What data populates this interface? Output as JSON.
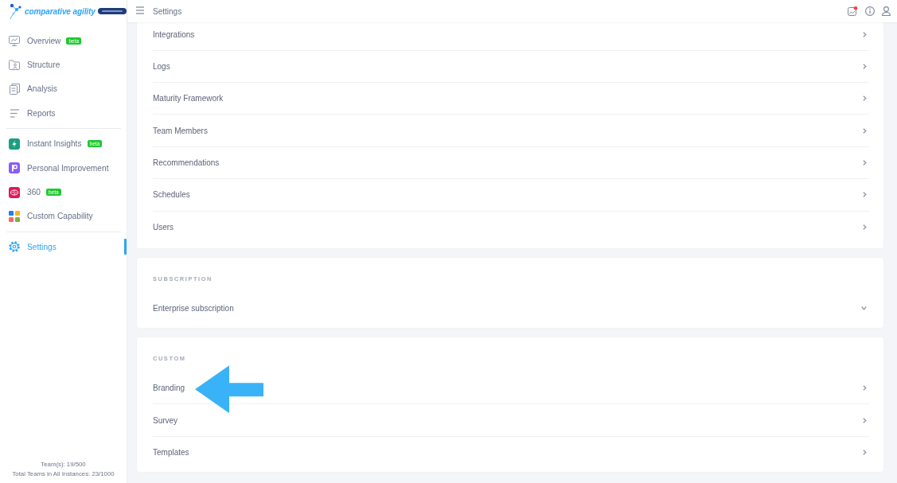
{
  "logo": {
    "text": "comparative agility"
  },
  "sidebar": {
    "groups": [
      {
        "items": [
          {
            "label": "Overview",
            "badge": "beta",
            "selected": false
          },
          {
            "label": "Structure",
            "selected": false
          },
          {
            "label": "Analysis",
            "selected": false
          },
          {
            "label": "Reports",
            "selected": false
          }
        ]
      },
      {
        "items": [
          {
            "label": "Instant Insights",
            "badge": "beta",
            "selected": false
          },
          {
            "label": "Personal Improvement",
            "selected": false
          },
          {
            "label": "360",
            "badge": "beta",
            "selected": false
          },
          {
            "label": "Custom Capability",
            "selected": false
          }
        ]
      },
      {
        "items": [
          {
            "label": "Settings",
            "selected": true
          }
        ]
      }
    ],
    "footer": [
      "Team(s): 19/500",
      "Total Teams in All Instances: 23/1000"
    ]
  },
  "topbar": {
    "title": "Settings",
    "alert_dot": true
  },
  "sections": [
    {
      "items": [
        {
          "label": "Integrations",
          "kind": "link",
          "pointed": false
        },
        {
          "label": "Logs",
          "kind": "link",
          "pointed": false
        },
        {
          "label": "Maturity Framework",
          "kind": "link",
          "pointed": false
        },
        {
          "label": "Team Members",
          "kind": "link",
          "pointed": false
        },
        {
          "label": "Recommendations",
          "kind": "link",
          "pointed": false
        },
        {
          "label": "Schedules",
          "kind": "link",
          "pointed": false
        },
        {
          "label": "Users",
          "kind": "link",
          "pointed": false
        }
      ]
    },
    {
      "heading": "SUBSCRIPTION",
      "items": [
        {
          "label": "Enterprise subscription",
          "kind": "accordion",
          "pointed": false
        }
      ]
    },
    {
      "heading": "CUSTOM",
      "items": [
        {
          "label": "Branding",
          "kind": "link",
          "pointed": true
        },
        {
          "label": "Survey",
          "kind": "link",
          "pointed": false
        },
        {
          "label": "Templates",
          "kind": "link",
          "pointed": false
        }
      ]
    }
  ]
}
